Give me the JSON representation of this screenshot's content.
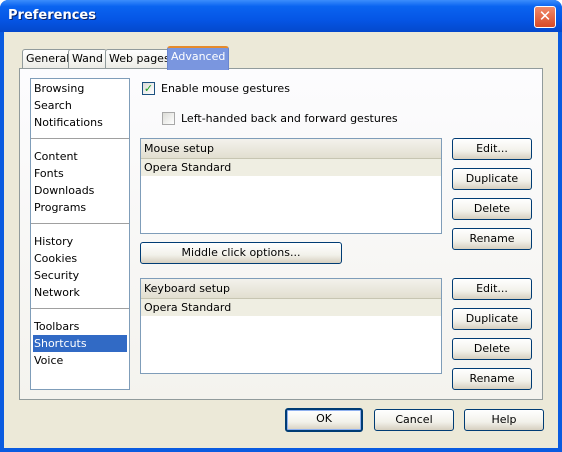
{
  "window": {
    "title": "Preferences",
    "close_glyph": "✕"
  },
  "tabs": [
    {
      "label": "General"
    },
    {
      "label": "Wand"
    },
    {
      "label": "Web pages"
    },
    {
      "label": "Advanced",
      "active": true
    }
  ],
  "sidebar": {
    "groups": [
      {
        "items": [
          "Browsing",
          "Search",
          "Notifications"
        ]
      },
      {
        "items": [
          "Content",
          "Fonts",
          "Downloads",
          "Programs"
        ]
      },
      {
        "items": [
          "History",
          "Cookies",
          "Security",
          "Network"
        ]
      },
      {
        "items": [
          "Toolbars",
          "Shortcuts",
          "Voice"
        ]
      }
    ],
    "selected": "Shortcuts"
  },
  "gestures": {
    "enable_label": "Enable mouse gestures",
    "enable_checked": true,
    "lefthanded_label": "Left-handed back and forward gestures",
    "lefthanded_checked": false,
    "check_glyph": "✓"
  },
  "mouse_setup": {
    "header": "Mouse setup",
    "rows": [
      "Opera Standard"
    ]
  },
  "middle_click_label": "Middle click options...",
  "keyboard_setup": {
    "header": "Keyboard setup",
    "rows": [
      "Opera Standard"
    ]
  },
  "setup_buttons": {
    "edit": "Edit...",
    "duplicate": "Duplicate",
    "delete": "Delete",
    "rename": "Rename"
  },
  "dialog_buttons": {
    "ok": "OK",
    "cancel": "Cancel",
    "help": "Help"
  }
}
